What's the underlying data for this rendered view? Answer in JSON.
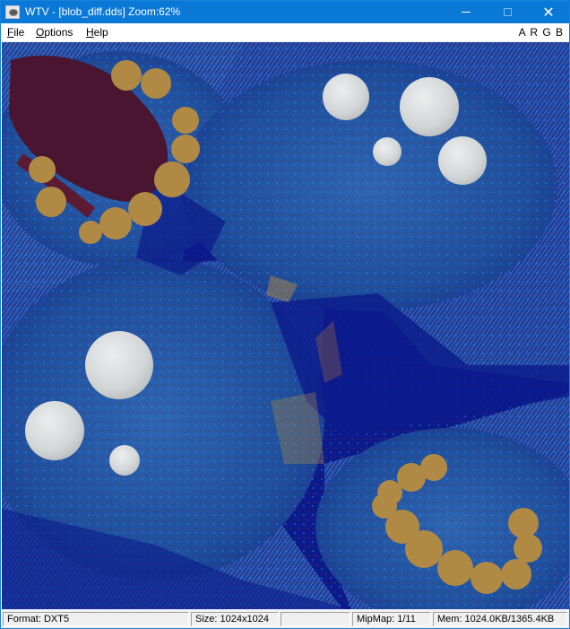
{
  "window": {
    "title": "WTV - [blob_diff.dds] Zoom:62%",
    "close_glyph": "✕"
  },
  "menu": {
    "items": [
      "File",
      "Options",
      "Help"
    ],
    "channels": "A R G B"
  },
  "status": {
    "format": "Format: DXT5",
    "size": "Size: 1024x1024",
    "empty": "",
    "mipmap": "MipMap: 1/11",
    "mem": "Mem: 1024.0KB/1365.4KB"
  },
  "texture": {
    "colors": {
      "deep_blue": "#0b1a8c",
      "mid_blue": "#1f4fa8",
      "light_blue": "#3b78c2",
      "dark_red": "#4a1530",
      "tan": "#b08a45",
      "white_circle": "#d9dbdc"
    }
  }
}
